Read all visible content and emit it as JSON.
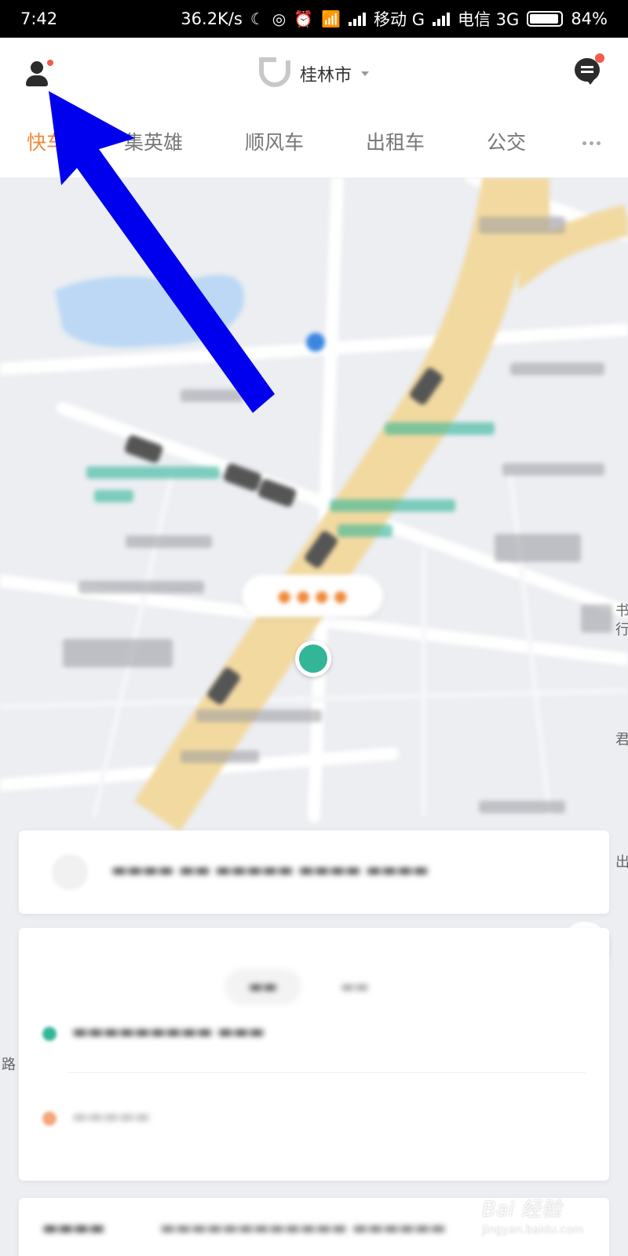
{
  "status_bar": {
    "time": "7:42",
    "speed": "36.2K/s",
    "carrier1": "移动 G",
    "carrier2": "电信 3G",
    "battery": "84%",
    "battery_level": 0.84
  },
  "header": {
    "city": "桂林市",
    "icons": [
      "user-icon",
      "didi-logo-icon",
      "message-icon"
    ]
  },
  "tabs": [
    {
      "label": "快车",
      "active": true
    },
    {
      "label": "集英雄",
      "active": false
    },
    {
      "label": "顺风车",
      "active": false
    },
    {
      "label": "出租车",
      "active": false
    },
    {
      "label": "公交",
      "active": false
    }
  ],
  "map": {
    "edge_labels": [
      "书",
      "行",
      "君",
      "出",
      "路"
    ]
  },
  "watermark": {
    "brand": "Bai 经验",
    "url": "jingyan.baidu.com"
  },
  "colors": {
    "accent": "#f08a3c",
    "pin": "#33b598",
    "arrow": "#0000ee",
    "road": "#f2d9a0"
  }
}
